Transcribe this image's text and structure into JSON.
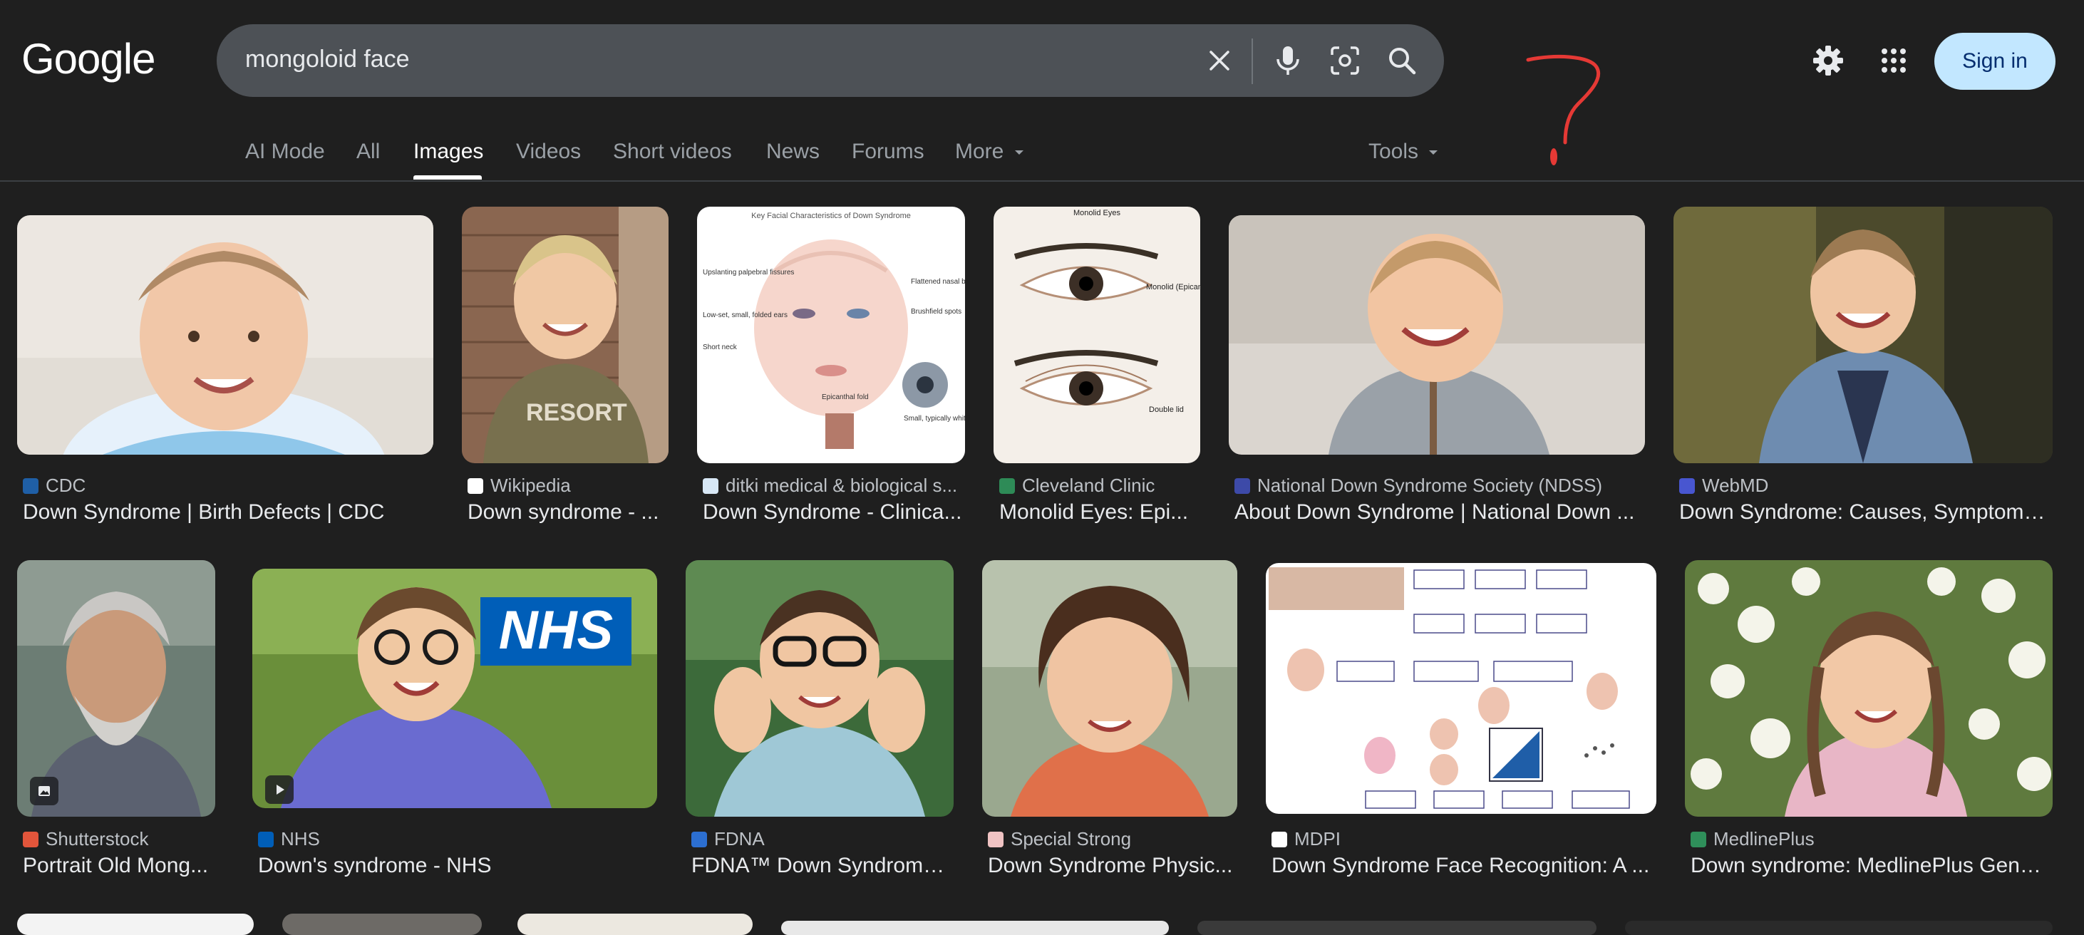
{
  "logo": "Google",
  "search": {
    "value": "mongoloid face"
  },
  "header": {
    "signin_label": "Sign in"
  },
  "tabs": [
    {
      "label": "AI Mode"
    },
    {
      "label": "All"
    },
    {
      "label": "Images",
      "active": true
    },
    {
      "label": "Videos"
    },
    {
      "label": "Short videos"
    },
    {
      "label": "News"
    },
    {
      "label": "Forums"
    },
    {
      "label": "More"
    }
  ],
  "tools_label": "Tools",
  "results": [
    {
      "source": "CDC",
      "title": "Down Syndrome | Birth Defects | CDC"
    },
    {
      "source": "Wikipedia",
      "title": "Down syndrome - ..."
    },
    {
      "source": "ditki medical & biological s...",
      "title": "Down Syndrome - Clinica..."
    },
    {
      "source": "Cleveland Clinic",
      "title": "Monolid Eyes: Epi..."
    },
    {
      "source": "National Down Syndrome Society (NDSS)",
      "title": "About Down Syndrome | National Down ..."
    },
    {
      "source": "WebMD",
      "title": "Down Syndrome: Causes, Symptoms ..."
    },
    {
      "source": "Shutterstock",
      "title": "Portrait Old Mong..."
    },
    {
      "source": "NHS",
      "title": "Down's syndrome - NHS"
    },
    {
      "source": "FDNA",
      "title": "FDNA™ Down Syndrome..."
    },
    {
      "source": "Special Strong",
      "title": "Down Syndrome Physic..."
    },
    {
      "source": "MDPI",
      "title": "Down Syndrome Face Recognition: A ..."
    },
    {
      "source": "MedlinePlus",
      "title": "Down syndrome: MedlinePlus Genet..."
    }
  ],
  "image_text": {
    "diagram_title": "Key Facial Characteristics of Down Syndrome",
    "diagram_labels": [
      "Upslanting palpebral fissures",
      "Flattened nasal bridge",
      "Low-set, small, folded ears",
      "Brushfield spots",
      "Short neck",
      "Epicanthal fold",
      "Small, typically white spots arranged in a ring"
    ],
    "eyes_title": "Monolid Eyes",
    "eyes_labels": [
      "Monolid (Epicanthal fold)",
      "Double lid"
    ],
    "nhs_logo": "NHS",
    "shirt_text": "RESORT"
  },
  "colors": {
    "accent_underline": "#ffffff",
    "signin_bg": "#c2e7ff",
    "annotation_red": "#e53935"
  }
}
